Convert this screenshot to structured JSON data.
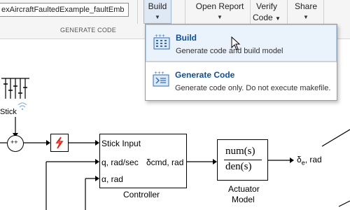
{
  "toolstrip": {
    "model_name": "exAircraftFaultedExample_faultEmb",
    "section_label": "GENERATE CODE",
    "build_label": "Build",
    "open_report_label": "Open Report",
    "verify_label_1": "Verify",
    "verify_label_2": "Code",
    "share_label": "Share"
  },
  "dropdown": {
    "items": [
      {
        "title": "Build",
        "description": "Generate code and build model",
        "icon": "build-grid-icon"
      },
      {
        "title": "Generate Code",
        "description": "Generate code only. Do not execute makefile.",
        "icon": "generate-code-icon"
      }
    ]
  },
  "diagram": {
    "stick_label": "Stick",
    "sum_signs": "++",
    "controller": {
      "name": "Controller",
      "ports_in": [
        "Stick Input",
        "q, rad/sec",
        "α, rad"
      ],
      "port_out": "δcmd, rad"
    },
    "actuator": {
      "name_line1": "Actuator",
      "name_line2": "Model",
      "numerator": "num(s)",
      "denominator": "den(s)"
    },
    "output_label": "δ",
    "output_sub": "e",
    "output_unit": ", rad"
  },
  "colors": {
    "toolstrip_bg": "#f5f5f5",
    "dropdown_title": "#0b4f9c",
    "hover_bg": "#eaf2fb",
    "fault_red": "#e0251b"
  }
}
